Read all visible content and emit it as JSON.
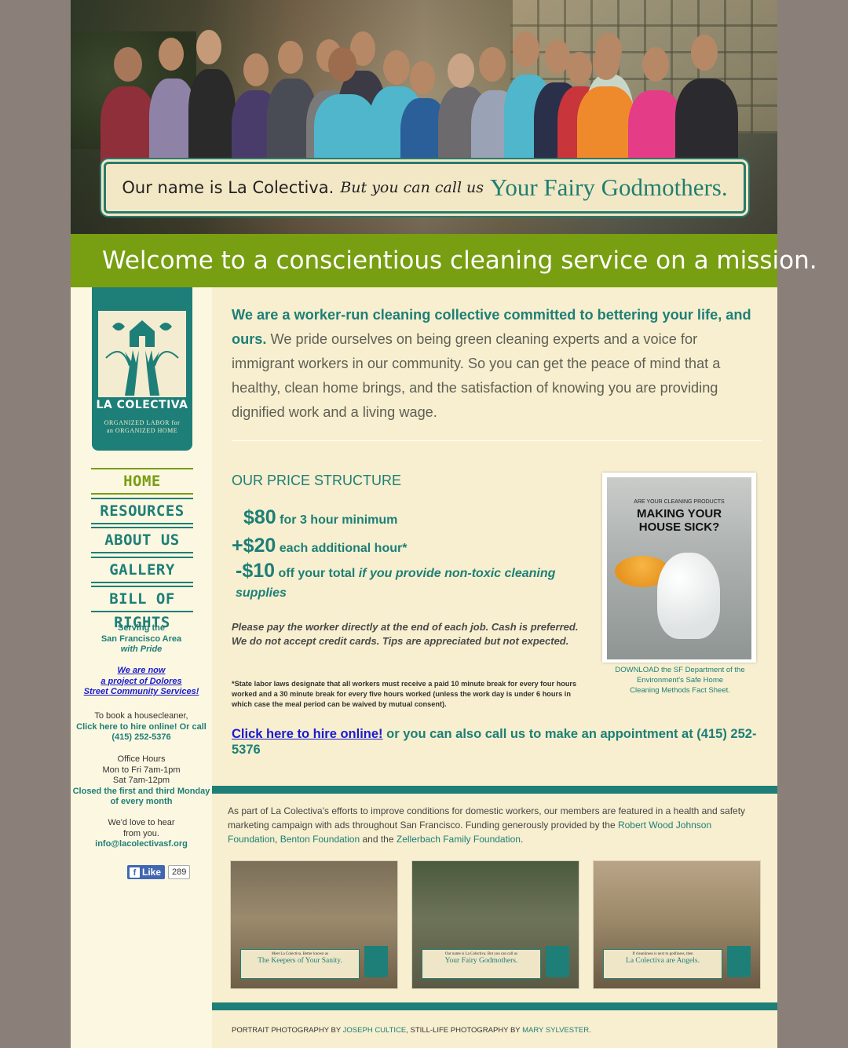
{
  "hero": {
    "banner_part1": "Our name is La Colectiva.",
    "banner_part2": "But you can call us",
    "banner_part3": "Your Fairy Godmothers."
  },
  "welcome": "Welcome to a conscientious cleaning service on a mission.",
  "logo": {
    "brand": "LA COLECTIVA",
    "tagline_1": "ORGANIZED LABOR for",
    "tagline_2": "an ORGANIZED HOME"
  },
  "nav": {
    "items": [
      "HOME",
      "RESOURCES",
      "ABOUT US",
      "GALLERY",
      "BILL OF RIGHTS"
    ],
    "active": "HOME"
  },
  "sidebar": {
    "serving_1": "Serving the",
    "serving_2": "San Francisco Area",
    "serving_3": "with Pride",
    "project_1": "We are now",
    "project_2": "a project of Dolores",
    "project_3": "Street Community Services!",
    "book_1": "To book a housecleaner,",
    "book_2": "Click here to hire online! Or call",
    "book_3": "(415) 252-5376",
    "hours_title": "Office Hours",
    "hours_1": "Mon to Fri 7am-1pm",
    "hours_2": "Sat 7am-12pm",
    "closed_1": "Closed the first and third Monday",
    "closed_2": "of every month",
    "hear_1": "We'd love to hear",
    "hear_2": "from you.",
    "email": "info@lacolectivasf.org"
  },
  "facebook": {
    "like_label": "Like",
    "count": "289"
  },
  "intro": {
    "lead": "We are a worker-run cleaning collective committed to bettering your life, and ours.",
    "body": " We pride ourselves on being green cleaning experts and a voice for immigrant workers in our community. So you can get the peace of mind that a healthy, clean home brings, and the satisfaction of knowing you are providing dignified work and a living wage."
  },
  "pricing": {
    "title": "OUR PRICE STRUCTURE",
    "line1_amount": "$80",
    "line1_desc": "for 3 hour minimum",
    "line2_amount": "+$20",
    "line2_desc": "each additional hour*",
    "line3_amount": "-$10",
    "line3_desc": "off your total",
    "line3_condition": "if you provide non-toxic cleaning supplies",
    "payment_note": "Please pay the worker directly at the end of each job. Cash is preferred. We do not accept credit cards. Tips are appreciated but not expected.",
    "law_note": "*State labor laws designate that all workers must receive a paid 10 minute break for every four hours worked and a 30 minute break for every five hours worked (unless the work day is under 6 hours in which case the meal period can be waived by mutual consent)."
  },
  "poster": {
    "kicker": "ARE YOUR CLEANING PRODUCTS",
    "headline_1": "MAKING YOUR",
    "headline_2": "HOUSE SICK?",
    "caption_1": "DOWNLOAD the SF Department of the",
    "caption_2": "Environment's Safe Home",
    "caption_3": "Cleaning Methods Fact Sheet."
  },
  "hire": {
    "link": "Click here to hire online!",
    "rest": " or you can also call us to make an appointment at (415) 252-5376"
  },
  "campaign": {
    "text_1": "As part of La Colectiva's efforts to improve conditions for domestic workers, our members are featured in a health and safety marketing campaign with ads throughout San Francisco. Funding generously provided by the ",
    "link_1": "Robert Wood Johnson Foundation",
    "text_2": ", ",
    "link_2": "Benton Foundation",
    "text_3": " and the ",
    "link_3": "Zellerbach Family Foundation",
    "text_4": ".",
    "ads": [
      {
        "kicker": "Meet La Colectiva. Better known as",
        "main": "The Keepers of Your Sanity."
      },
      {
        "kicker": "Our name is La Colectiva. But you can call us",
        "main": "Your Fairy Godmothers."
      },
      {
        "kicker": "If cleanliness is next to godliness, then",
        "main": "La Colectiva are Angels."
      }
    ]
  },
  "credits": {
    "prefix": "PORTRAIT PHOTOGRAPHY BY ",
    "photographer_1": "JOSEPH CULTICE",
    "middle": ", STILL-LIFE PHOTOGRAPHY BY ",
    "photographer_2": "MARY SYLVESTER",
    "suffix": "."
  },
  "colors": {
    "teal": "#1d7f77",
    "green": "#789e12",
    "cream": "#f7efcf",
    "link_blue": "#1a1ad0",
    "outer_bg": "#8a8079"
  }
}
